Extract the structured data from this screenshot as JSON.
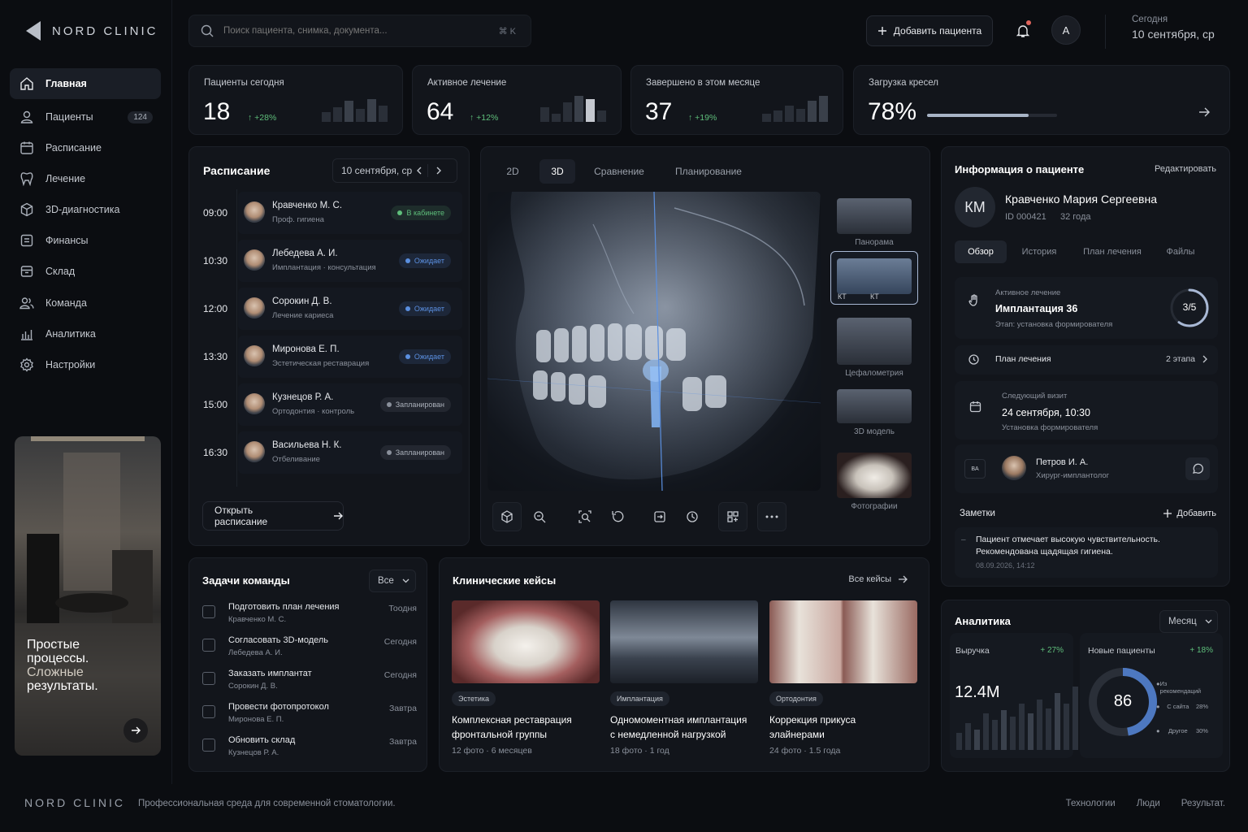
{
  "brand": {
    "name": "NORD CLINIC",
    "tagline": "Профессиональная среда для современной стоматологии."
  },
  "sidebar": {
    "items": [
      {
        "label": "Главная",
        "icon": "home-icon",
        "active": true
      },
      {
        "label": "Пациенты",
        "icon": "user-icon",
        "badge": "124"
      },
      {
        "label": "Расписание",
        "icon": "calendar-icon"
      },
      {
        "label": "Лечение",
        "icon": "tooth-icon"
      },
      {
        "label": "3D-диагностика",
        "icon": "cube-icon"
      },
      {
        "label": "Финансы",
        "icon": "wallet-icon"
      },
      {
        "label": "Склад",
        "icon": "box-icon"
      },
      {
        "label": "Команда",
        "icon": "team-icon"
      },
      {
        "label": "Аналитика",
        "icon": "chart-icon"
      },
      {
        "label": "Настройки",
        "icon": "gear-icon"
      }
    ],
    "promo": {
      "line1": "Простые",
      "line2": "процессы.",
      "line3": "Сложные",
      "line4": "результаты."
    }
  },
  "header": {
    "search_placeholder": "Поиск пациента, снимка, документа...",
    "shortcut": "⌘ K",
    "add_patient": "Добавить пациента",
    "avatar_initial": "A",
    "today_label": "Сегодня",
    "today_date": "10 сентября, ср"
  },
  "stats": [
    {
      "label": "Пациенты сегодня",
      "value": "18",
      "change": "+28%"
    },
    {
      "label": "Активное лечение",
      "value": "64",
      "change": "+12%"
    },
    {
      "label": "Завершено в этом месяце",
      "value": "37",
      "change": "+19%"
    },
    {
      "label": "Загрузка кресел",
      "value": "78%",
      "progress": 0.78
    }
  ],
  "schedule": {
    "title": "Расписание",
    "date": "10 сентября, ср",
    "open_button": "Открыть расписание",
    "rows": [
      {
        "time": "09:00",
        "name": "Кравченко М. С.",
        "sub": "Проф. гигиена",
        "status": "В кабинете",
        "color": "#5fbf7b"
      },
      {
        "time": "10:30",
        "name": "Лебедева А. И.",
        "sub": "Имплантация · консультация",
        "status": "Ожидает",
        "color": "#5a8fe0"
      },
      {
        "time": "12:00",
        "name": "Сорокин Д. В.",
        "sub": "Лечение кариеса",
        "status": "Ожидает",
        "color": "#5a8fe0"
      },
      {
        "time": "13:30",
        "name": "Миронова Е. П.",
        "sub": "Эстетическая реставрация",
        "status": "Ожидает",
        "color": "#5a8fe0"
      },
      {
        "time": "15:00",
        "name": "Кузнецов Р. А.",
        "sub": "Ортодонтия · контроль",
        "status": "Запланирован",
        "color": "#8a909b"
      },
      {
        "time": "16:30",
        "name": "Васильева Н. К.",
        "sub": "Отбеливание",
        "status": "Запланирован",
        "color": "#8a909b"
      }
    ]
  },
  "viewer": {
    "tabs": [
      "2D",
      "3D",
      "Сравнение",
      "Планирование"
    ],
    "thumbs": [
      "Панорама",
      "КТ",
      "Цефалометрия",
      "3D модель",
      "Фотографии"
    ],
    "kt_label_left": "КТ",
    "kt_label_right": "КТ"
  },
  "patient": {
    "section": "Информация о пациенте",
    "edit": "Редактировать",
    "initials": "КМ",
    "name": "Кравченко Мария Сергеевна",
    "id": "ID 000421",
    "age": "32 года",
    "tabs": [
      "Обзор",
      "История",
      "План лечения",
      "Файлы"
    ],
    "active_treatment_label": "Активное лечение",
    "active_treatment": "Имплантация 36",
    "stage": "Этап: установка формирователя",
    "progress_text": "3/5",
    "progress": 0.6,
    "plan_label": "План лечения",
    "plan_count": "2 этапа",
    "next_visit_label": "Следующий визит",
    "next_visit": "24 сентября, 10:30",
    "next_visit_desc": "Установка формирователя",
    "doctor_name": "Петров И. А.",
    "doctor_role": "Хирург-имплантолог",
    "notes_title": "Заметки",
    "notes_add": "Добавить",
    "note_line1": "Пациент отмечает высокую чувствительность.",
    "note_line2": "Рекомендована щадящая гигиена.",
    "note_date": "08.09.2026, 14:12"
  },
  "tasks": {
    "title": "Задачи команды",
    "filter": "Все",
    "items": [
      {
        "title": "Подготовить план лечения",
        "who": "Кравченко М. С.",
        "when": "Тоодня"
      },
      {
        "title": "Согласовать 3D-модель",
        "who": "Лебедева А. И.",
        "when": "Сегодня"
      },
      {
        "title": "Заказать имплантат",
        "who": "Сорокин Д. В.",
        "when": "Сегодня"
      },
      {
        "title": "Провести фотопротокол",
        "who": "Миронова Е. П.",
        "when": "Завтра"
      },
      {
        "title": "Обновить склад",
        "who": "Кузнецов Р. А.",
        "when": "Завтра"
      }
    ]
  },
  "cases": {
    "title": "Клинические кейсы",
    "all": "Все кейсы",
    "items": [
      {
        "tag": "Эстетика",
        "title1": "Комплексная реставрация",
        "title2": "фронтальной группы",
        "meta": "12 фото · 6 месяцев"
      },
      {
        "tag": "Имплантация",
        "title1": "Одномоментная имплантация",
        "title2": "с немедленной нагрузкой",
        "meta": "18 фото · 1 год"
      },
      {
        "tag": "Ортодонтия",
        "title1": "Коррекция прикуса",
        "title2": "элайнерами",
        "meta": "24 фото · 1.5 года"
      }
    ]
  },
  "analytics": {
    "title": "Аналитика",
    "period": "Месяц",
    "revenue_label": "Выручка",
    "revenue_change": "+ 27%",
    "revenue_value": "12.4M",
    "revenue_bars": [
      0.25,
      0.4,
      0.3,
      0.55,
      0.45,
      0.6,
      0.5,
      0.7,
      0.55,
      0.75,
      0.62,
      0.85,
      0.7,
      0.95
    ],
    "new_label": "Новые пациенты",
    "new_change": "+ 18%",
    "new_value": "86",
    "legend": [
      {
        "label": "Из рекомендаций",
        "pct": ""
      },
      {
        "label": "С сайта",
        "pct": "28%"
      },
      {
        "label": "Другое",
        "pct": "30%"
      }
    ]
  },
  "footer": {
    "links": [
      "Технологии",
      "Люди",
      "Результат."
    ]
  },
  "colors": {
    "accent": "#5a8fe0",
    "positive": "#5fbf7b",
    "bg": "#0b0d11",
    "card": "#12151b"
  }
}
